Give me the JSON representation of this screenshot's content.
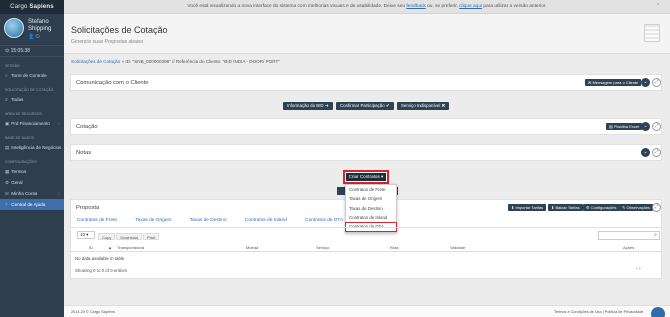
{
  "app": {
    "brand_left": "Cargo",
    "brand_right": "Sapiens"
  },
  "profile": {
    "name": "Stefano Shipping",
    "icons": "👤 ⏻"
  },
  "time": "15:05:38",
  "sidebar": {
    "sections": [
      {
        "title": "Sessão",
        "items": [
          {
            "icon": "⌂",
            "label": "Torre de Controle"
          }
        ]
      },
      {
        "title": "Solicitação de Cotação",
        "items": [
          {
            "icon": "≡",
            "label": "Todas"
          }
        ]
      },
      {
        "title": "Área de Recursos",
        "items": [
          {
            "icon": "▣",
            "label": "Prd Financiamento",
            "chevron": "‹"
          }
        ]
      },
      {
        "title": "Base de Dados",
        "items": [
          {
            "icon": "▤",
            "label": "Inteligência de Negócios"
          }
        ]
      },
      {
        "title": "Configurações",
        "items": [
          {
            "icon": "▦",
            "label": "Termos"
          },
          {
            "icon": "⚙",
            "label": "Geral"
          },
          {
            "icon": "✉",
            "label": "Minha Conta",
            "chevron": "‹"
          },
          {
            "icon": "?",
            "label": "Central de Ajuda",
            "active": true
          }
        ]
      }
    ]
  },
  "banner": {
    "text_before": "Você está visualizando a nova interface do sistema com melhorias visuais e de usabilidade. Deixe seu ",
    "link1": "feedback",
    "text_mid": " ou, se preferir, ",
    "link2": "clique aqui",
    "text_after": " para utilizar a versão anterior.",
    "collapse": "⌃"
  },
  "page": {
    "title": "Solicitações de Cotação",
    "subtitle": "Gerencie suas Propostas abaixo"
  },
  "breadcrumb": {
    "link": "Solicitações de Cotação",
    "rest": " » ID: \"SNB_000000396\" // Referência do Cliente: \"BID INDIA - DOOR/ PORT\""
  },
  "comunicacao": {
    "title": "Comunicação com o Cliente",
    "button": "✉ Mensagem para o Cliente"
  },
  "action_buttons": {
    "info": "Informação do BID ➜",
    "confirmar": "Confirmar Participação ✔",
    "indisponivel": "Serviço Indisponível ✖"
  },
  "cotacao": {
    "title": "Cotação",
    "button": "▤ Planilha Excel"
  },
  "notas": {
    "title": "Notas"
  },
  "criar": {
    "label": "Criar Contratos ▾",
    "options": [
      "Contratos de Frete",
      "Taxas de Origem",
      "Taxas de Destino",
      "Contratos de Inland",
      "Contratos de DTA"
    ]
  },
  "proposta": {
    "title": "Proposta",
    "buttons": [
      "⬇ Importar Tarifas",
      "⬇ Baixar Tarifas",
      "⚙ Configurações",
      "✎ Observações"
    ],
    "tabs": [
      "Contratos de Frete",
      "Taxas de Origem",
      "Taxas de Destino",
      "Contratos de Inland",
      "Contratos de DTA"
    ],
    "page_size": "10",
    "export": [
      "Copy",
      "Download",
      "Print"
    ],
    "columns": [
      "ID",
      "Transportadora",
      "Moeda",
      "Serviço",
      "Rota",
      "Validade",
      "Ações"
    ],
    "no_data": "No data available in table",
    "showing": "Showing 0 to 0 of 0 entries",
    "pager": "‹   ›"
  },
  "footer": {
    "left": "2014-20 © Cargo Sapiens",
    "right": "Termos e Condições de Uso  |  Política de Privacidade"
  },
  "colors": {
    "sidebar": "#2f3e4e",
    "accent": "#2d4253",
    "highlight": "#d9232d",
    "link": "#2f6db3"
  }
}
